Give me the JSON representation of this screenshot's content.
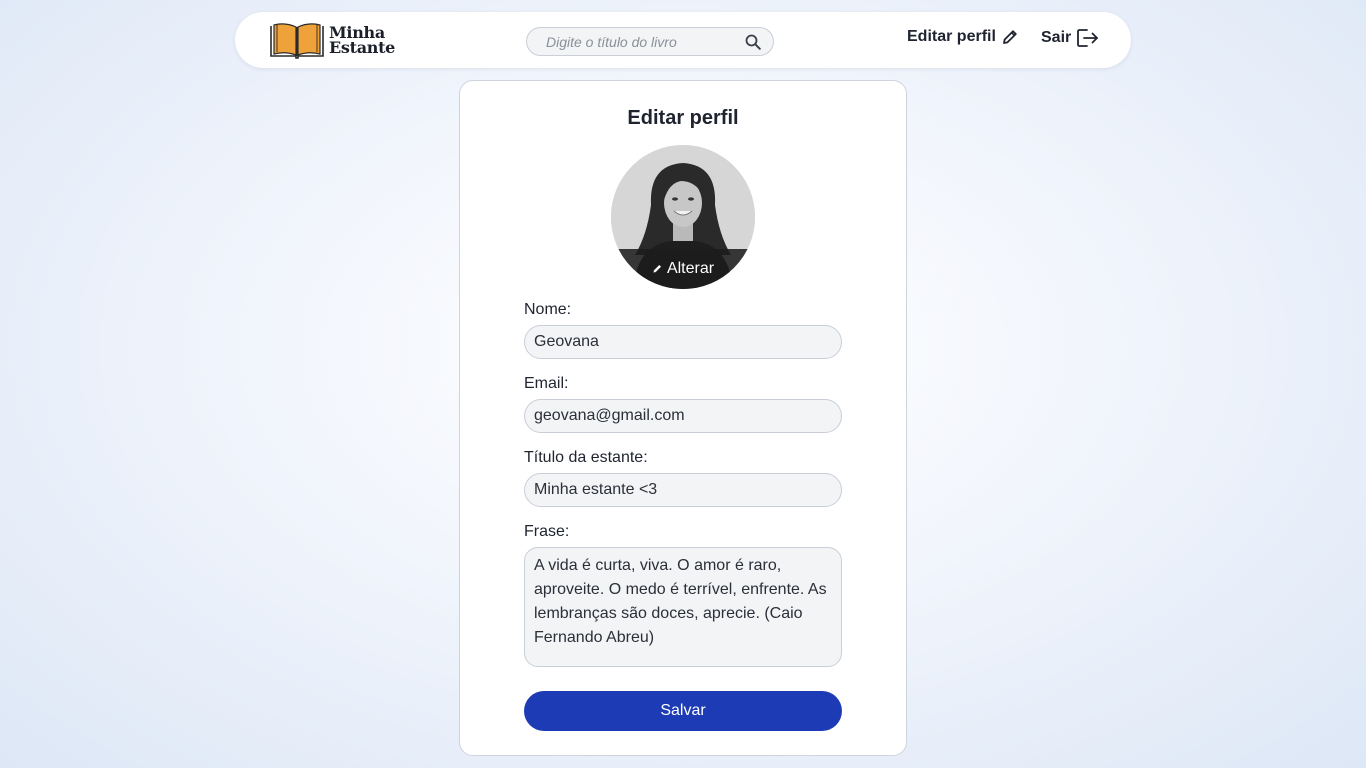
{
  "header": {
    "logo_line1": "Minha",
    "logo_line2": "Estante",
    "search_placeholder": "Digite o título do livro",
    "edit_profile_label": "Editar perfil",
    "exit_label": "Sair"
  },
  "form": {
    "title": "Editar perfil",
    "avatar_change_label": "Alterar",
    "name_label": "Nome:",
    "name_value": "Geovana",
    "email_label": "Email:",
    "email_value": "geovana@gmail.com",
    "shelf_title_label": "Título da estante:",
    "shelf_title_value": "Minha estante <3",
    "phrase_label": "Frase:",
    "phrase_value": "A vida é curta, viva. O amor é raro, aproveite. O medo é terrível, enfrente. As lembranças são doces, aprecie. (Caio Fernando Abreu)",
    "save_label": "Salvar"
  },
  "icons": {
    "logo": "open-book-icon",
    "search": "search-icon",
    "edit": "pencil-icon",
    "exit": "logout-icon",
    "avatar_edit": "pencil-icon"
  },
  "colors": {
    "accent": "#1c3bb5",
    "logo_orange": "#f0a23a"
  }
}
